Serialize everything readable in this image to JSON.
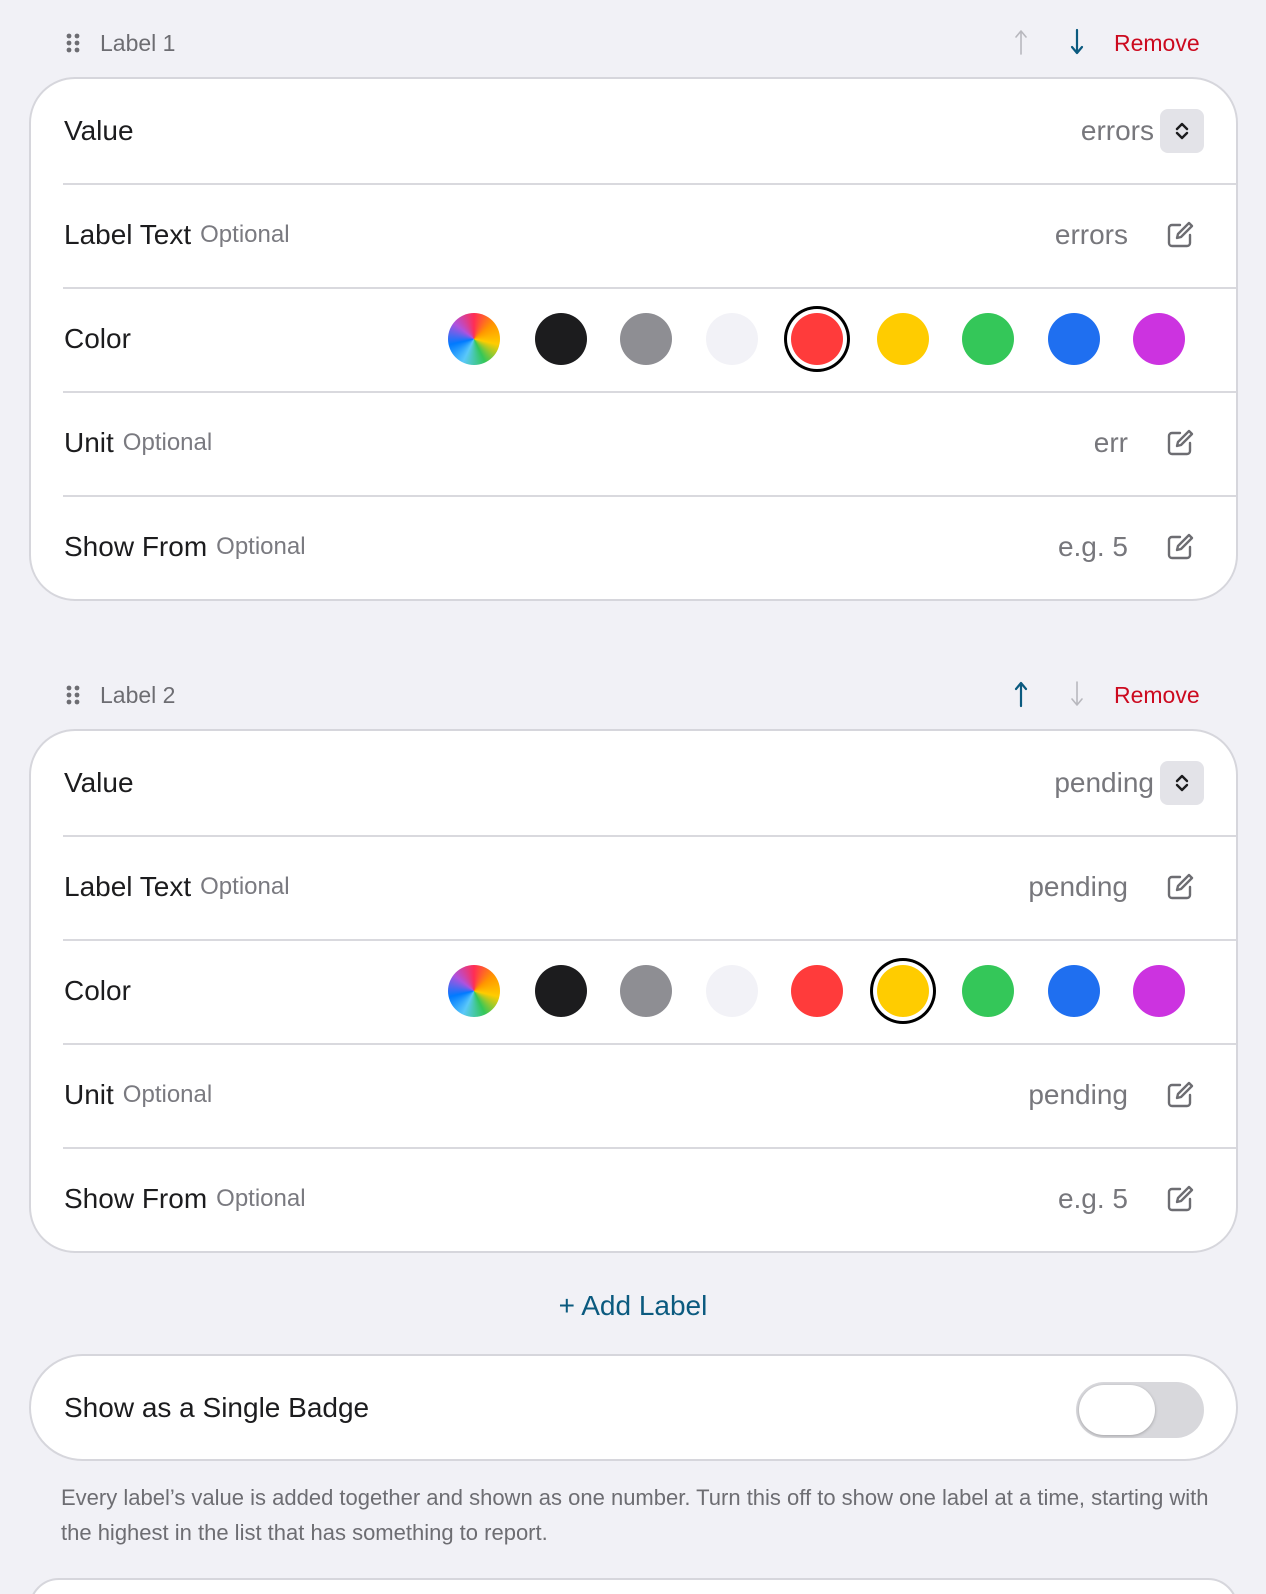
{
  "labels": [
    {
      "title": "Label 1",
      "remove_label": "Remove",
      "value_title": "Value",
      "value": "errors",
      "label_text_title": "Label Text",
      "label_text_optional": "Optional",
      "label_text_value": "errors",
      "color_title": "Color",
      "selected_color": "red",
      "unit_title": "Unit",
      "unit_optional": "Optional",
      "unit_value": "err",
      "show_from_title": "Show From",
      "show_from_optional": "Optional",
      "show_from_placeholder": "e.g. 5"
    },
    {
      "title": "Label 2",
      "remove_label": "Remove",
      "value_title": "Value",
      "value": "pending",
      "label_text_title": "Label Text",
      "label_text_optional": "Optional",
      "label_text_value": "pending",
      "color_title": "Color",
      "selected_color": "yellow",
      "unit_title": "Unit",
      "unit_optional": "Optional",
      "unit_value": "pending",
      "show_from_title": "Show From",
      "show_from_optional": "Optional",
      "show_from_placeholder": "e.g. 5"
    }
  ],
  "colors": {
    "black": "#1c1c1e",
    "gray": "#8e8e93",
    "light": "#f2f2f7",
    "red": "#ff3b3b",
    "yellow": "#ffcc00",
    "green": "#34c759",
    "blue": "#1f6ff0",
    "purple": "#cc33e0",
    "accent": "#0b5a7f",
    "destructive": "#cc0a1f"
  },
  "add_label": "+ Add Label",
  "single_badge": {
    "title": "Show as a Single Badge",
    "enabled": false,
    "footnote": "Every label’s value is added together and shown as one number. Turn this off to show one label at a time, starting with the highest in the list that has something to report."
  }
}
